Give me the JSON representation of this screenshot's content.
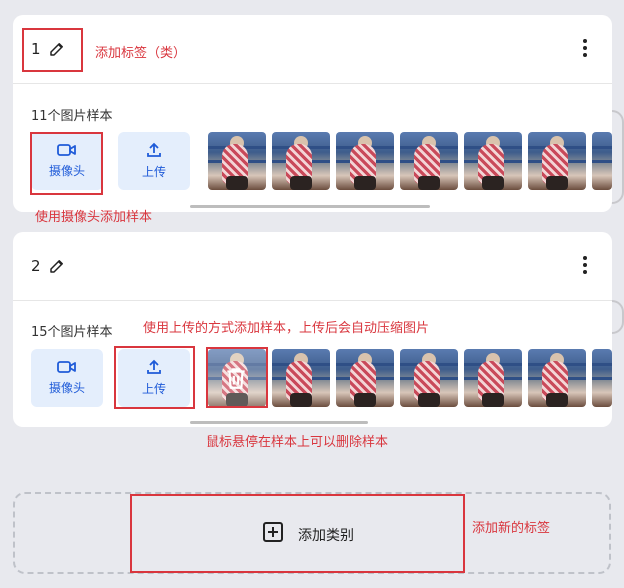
{
  "cards": [
    {
      "number": "1",
      "sample_count": "11个图片样本",
      "camera_label": "摄像头",
      "upload_label": "上传"
    },
    {
      "number": "2",
      "sample_count": "15个图片样本",
      "camera_label": "摄像头",
      "upload_label": "上传"
    }
  ],
  "add_category": {
    "label": "添加类别"
  },
  "annotations": {
    "edit_label": "添加标签（类）",
    "camera_note": "使用摄像头添加样本",
    "upload_note": "使用上传的方式添加样本，上传后会自动压缩图片",
    "delete_note": "鼠标悬停在样本上可以删除样本",
    "add_note": "添加新的标签"
  },
  "icons": {
    "edit": "pencil-icon",
    "menu": "more-vertical-icon",
    "camera": "video-camera-icon",
    "upload": "upload-icon",
    "delete": "trash-icon",
    "add": "plus-square-icon"
  },
  "colors": {
    "accent": "#1f5bd8",
    "button_bg": "#e4eefc",
    "annotation": "#d9363e",
    "background": "#e8e9ee"
  }
}
